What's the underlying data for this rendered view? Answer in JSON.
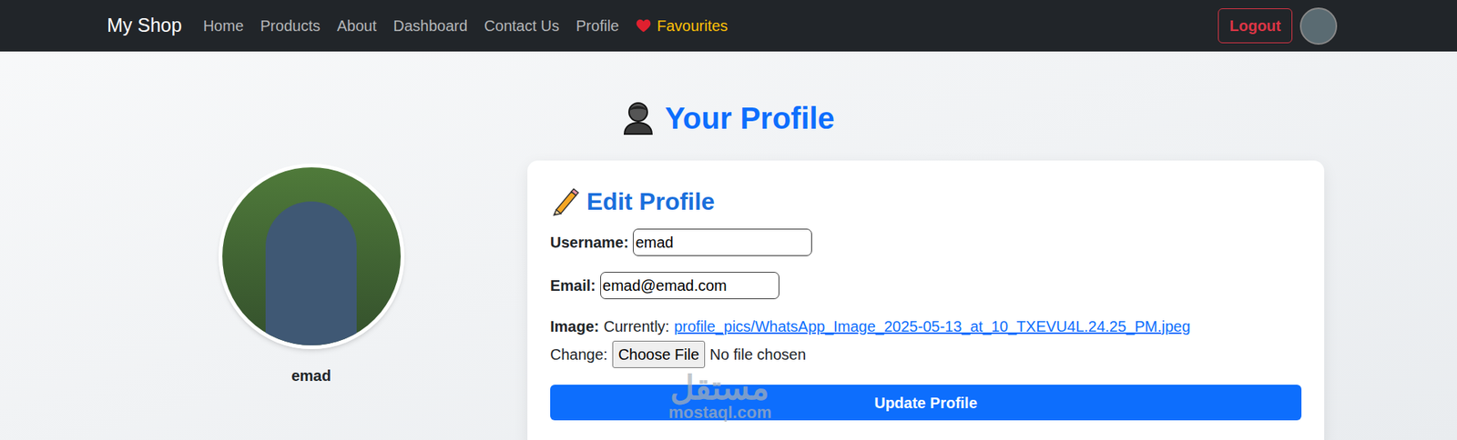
{
  "navbar": {
    "brand": "My Shop",
    "links": [
      {
        "label": "Home",
        "kind": "link"
      },
      {
        "label": "Products",
        "kind": "link"
      },
      {
        "label": "About",
        "kind": "link"
      },
      {
        "label": "Dashboard",
        "kind": "link"
      },
      {
        "label": "Contact Us",
        "kind": "link"
      },
      {
        "label": "Profile",
        "kind": "link"
      },
      {
        "label": "Favourites",
        "kind": "favourite"
      }
    ],
    "logout": "Logout"
  },
  "page": {
    "title": "Your Profile"
  },
  "profile": {
    "name": "emad"
  },
  "form": {
    "title": "Edit Profile",
    "fields": [
      {
        "label": "Username:",
        "value": "emad"
      },
      {
        "label": "Email:",
        "value": "emad@emad.com"
      }
    ],
    "image": {
      "label": "Image:",
      "currently_label": "Currently:",
      "current_file": "profile_pics/WhatsApp_Image_2025-05-13_at_10_TXEVU4L.24.25_PM.jpeg",
      "change_label": "Change:",
      "choose_button": "Choose File",
      "file_status": "No file chosen"
    },
    "submit": "Update Profile"
  },
  "watermark": {
    "arabic": "مستقل",
    "url": "mostaql.com"
  }
}
